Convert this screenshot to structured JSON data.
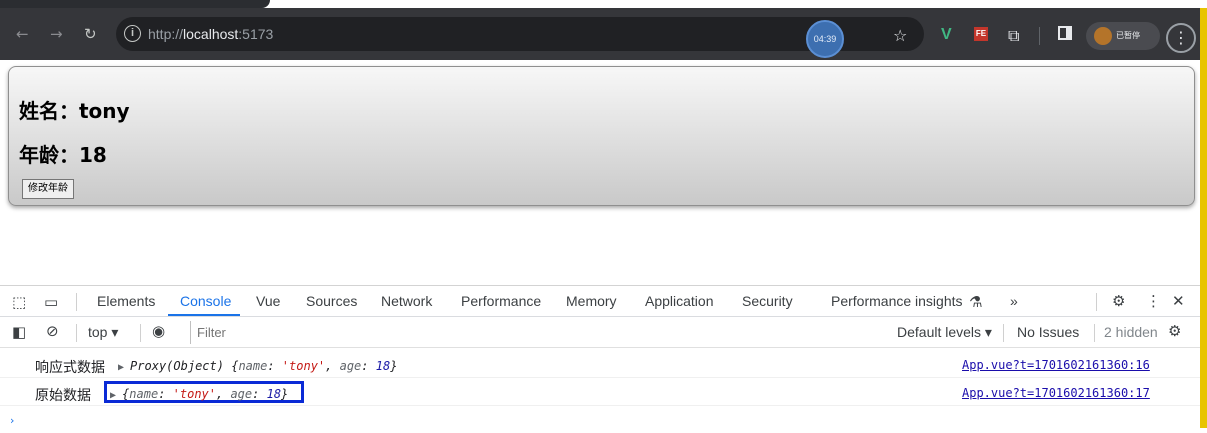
{
  "browser": {
    "url_prefix": "http://",
    "url_host": "localhost",
    "url_port": ":5173",
    "timer": "04:39",
    "profile_label": "已暂停",
    "icons": {
      "back": "back-arrow-icon",
      "forward": "forward-arrow-icon",
      "reload": "reload-icon",
      "info": "info-icon",
      "bookmark": "star-icon",
      "vue_ext": "vue-devtools-icon",
      "fe_ext": "fe-extension-icon",
      "puzzle": "extensions-icon",
      "sidepanel": "side-panel-icon",
      "menu": "kebab-menu-icon"
    }
  },
  "page": {
    "name_line": "姓名：tony",
    "age_line": "年龄：18",
    "button_label": "修改年龄"
  },
  "devtools": {
    "tabs": [
      "Elements",
      "Console",
      "Vue",
      "Sources",
      "Network",
      "Performance",
      "Memory",
      "Application",
      "Security",
      "Performance insights"
    ],
    "active_tab": "Console",
    "overflow": "»",
    "context": "top",
    "filter_placeholder": "Filter",
    "default_levels": "Default levels",
    "issues": "No Issues",
    "hidden": "2 hidden",
    "logs": [
      {
        "label": "响应式数据",
        "prefix": "Proxy(Object) ",
        "source": "App.vue?t=1701602161360:16"
      },
      {
        "label": "原始数据",
        "prefix": "",
        "source": "App.vue?t=1701602161360:17"
      }
    ],
    "object": {
      "key_name": "name",
      "value_name": "'tony'",
      "key_age": "age",
      "value_age": "18"
    },
    "colors": {
      "active_tab": "#1a73e8",
      "string_value": "#c41a16",
      "number_value": "#1a1aa6",
      "highlight_box": "#0a2ad6"
    }
  }
}
